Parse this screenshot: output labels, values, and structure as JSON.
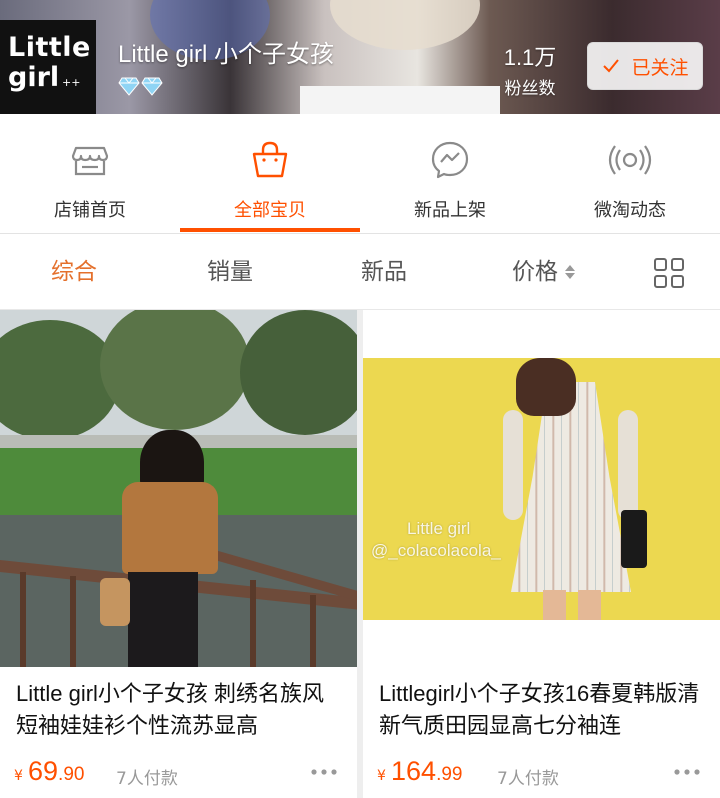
{
  "header": {
    "logo_line1": "Little",
    "logo_line2": "girl",
    "logo_mark": "++",
    "shop_name": "Little girl  小个子女孩",
    "rating_icons": [
      "diamond-icon",
      "diamond-icon"
    ],
    "fans_count": "1.1万",
    "fans_label": "粉丝数",
    "follow_label": "已关注",
    "follow_icon": "check-icon"
  },
  "nav": {
    "items": [
      {
        "label": "店铺首页",
        "icon": "storefront-icon"
      },
      {
        "label": "全部宝贝",
        "icon": "shopping-bag-icon",
        "active": true
      },
      {
        "label": "新品上架",
        "icon": "new-arrival-chat-icon"
      },
      {
        "label": "微淘动态",
        "icon": "broadcast-icon"
      }
    ]
  },
  "sort": {
    "items": [
      {
        "label": "综合",
        "active": true
      },
      {
        "label": "销量"
      },
      {
        "label": "新品"
      },
      {
        "label": "价格",
        "icon": "sort-arrows-icon"
      }
    ],
    "view_toggle_icon": "grid-view-icon"
  },
  "products": [
    {
      "title": "Little girl小个子女孩 刺绣名族风短袖娃娃衫个性流苏显高",
      "currency": "¥",
      "price_int": "69",
      "price_dec": ".90",
      "sales": "7人付款",
      "more_icon": "more-dots-icon"
    },
    {
      "title": "Littlegirl小个子女孩16春夏韩版清新气质田园显高七分袖连",
      "currency": "¥",
      "price_int": "164",
      "price_dec": ".99",
      "sales": "7人付款",
      "more_icon": "more-dots-icon",
      "watermark_line1": "Little girl",
      "watermark_line2": "@_colacolacola_"
    }
  ],
  "colors": {
    "accent": "#ff5000",
    "sort_active": "#e4702c",
    "text_primary": "#111111",
    "text_secondary": "#999999"
  }
}
